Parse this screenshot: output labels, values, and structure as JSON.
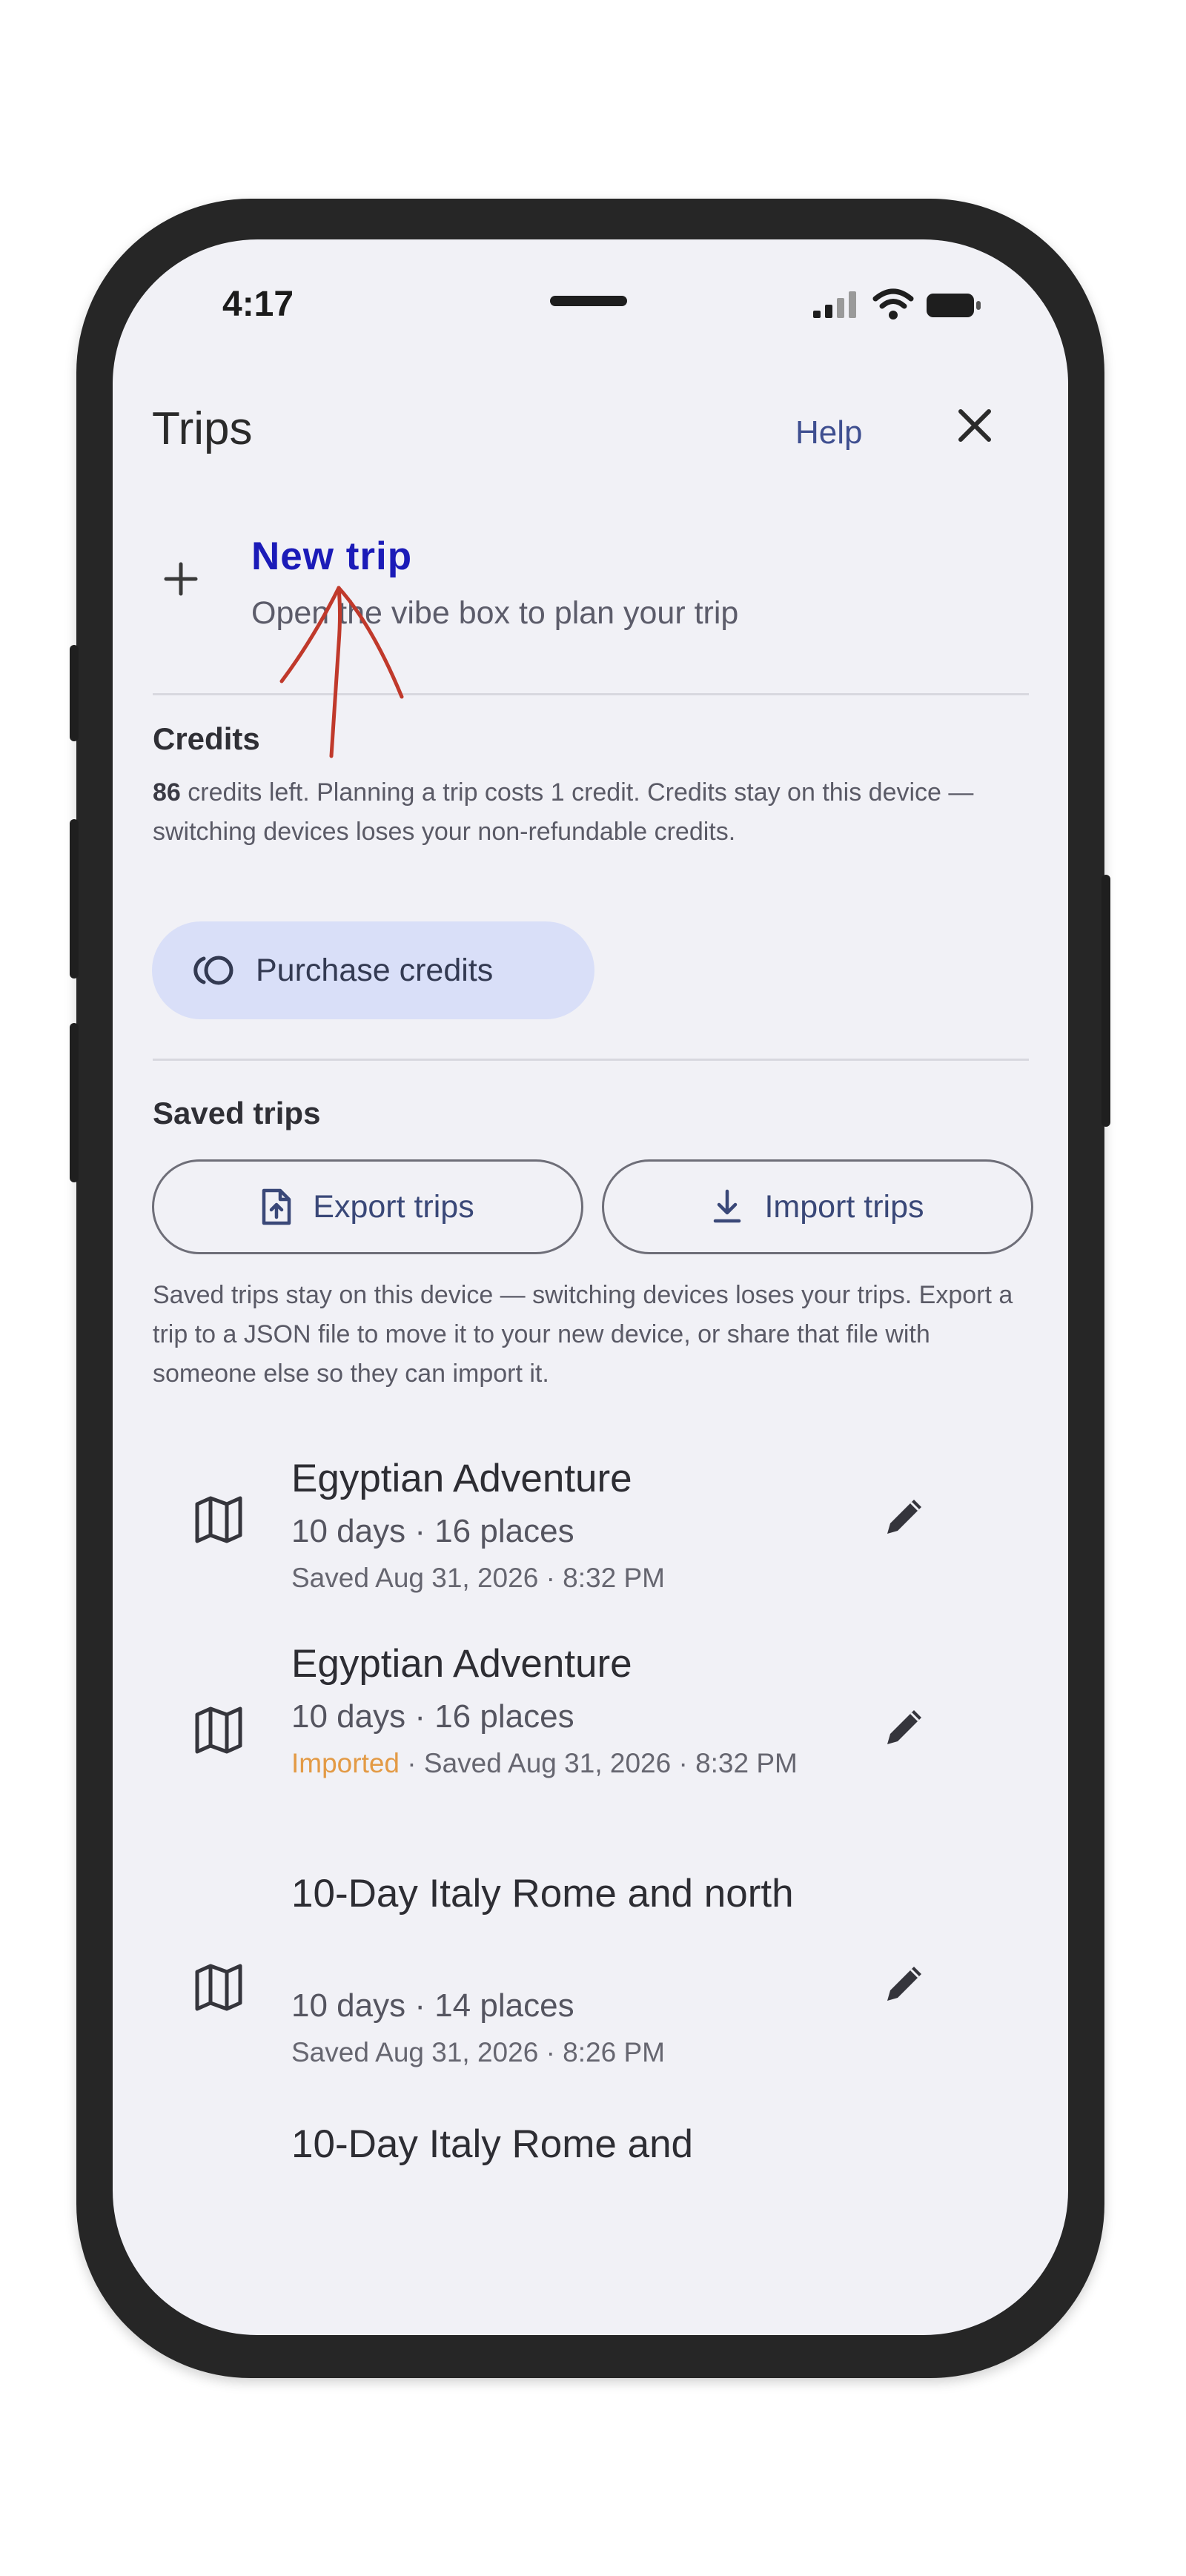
{
  "status_bar": {
    "time": "4:17"
  },
  "header": {
    "title": "Trips",
    "help_label": "Help",
    "close_icon": "close-icon"
  },
  "new_trip": {
    "label": "New trip",
    "subtitle": "Open the vibe box to plan your trip",
    "icon": "plus-icon"
  },
  "credits": {
    "heading": "Credits",
    "count": "86",
    "description": " credits left. Planning a trip costs 1 credit. Credits stay on this device — switching devices loses your non-refundable credits.",
    "purchase_label": "Purchase credits",
    "purchase_icon": "coins-icon"
  },
  "saved_trips": {
    "heading": "Saved trips",
    "export_label": "Export trips",
    "import_label": "Import trips",
    "description": "Saved trips stay on this device — switching devices loses your trips. Export a trip to a JSON file to move it to your new device, or share that file with someone else so they can import it.",
    "items": [
      {
        "title": "Egyptian Adventure",
        "meta": "10 days · 16 places",
        "imported": "",
        "saved": "Saved Aug 31, 2026 · 8:32 PM"
      },
      {
        "title": "Egyptian Adventure",
        "meta": "10 days · 16 places",
        "imported": "Imported",
        "saved": " · Saved Aug 31, 2026 · 8:32 PM"
      },
      {
        "title": "10-Day Italy Rome and north",
        "meta": "10 days · 14 places",
        "imported": "",
        "saved": "Saved Aug 31, 2026 · 8:26 PM"
      },
      {
        "title": "10-Day Italy Rome and",
        "meta": "",
        "imported": "",
        "saved": ""
      }
    ]
  },
  "colors": {
    "accent": "#1b1bb8",
    "help": "#3f4f90",
    "purchase_bg": "#d9dff8",
    "imported": "#e39a45",
    "annotation": "#c0392b",
    "screen_bg": "#f1f1f6"
  }
}
